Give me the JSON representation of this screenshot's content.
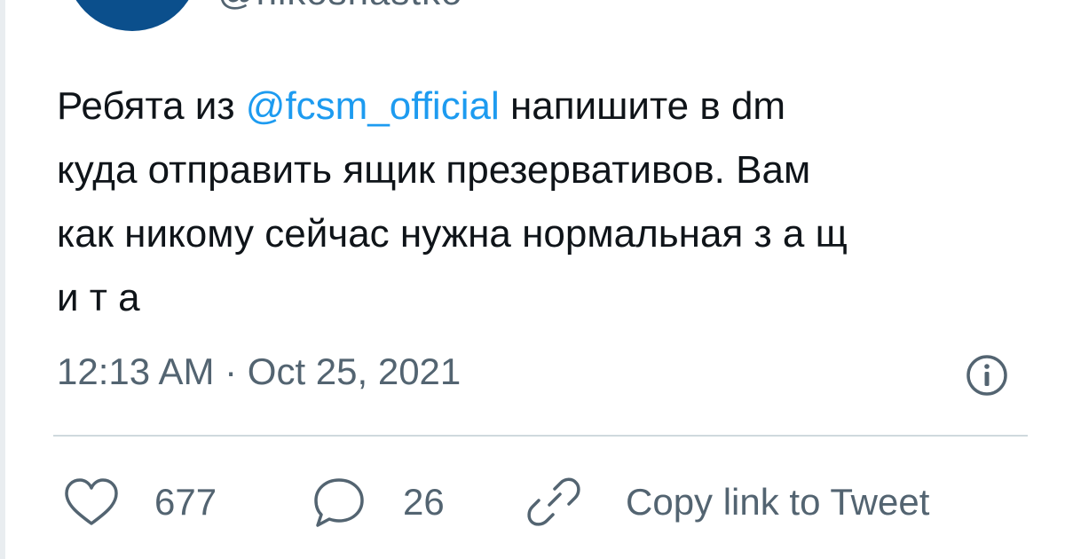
{
  "author": {
    "handle": "@nikosnastko"
  },
  "tweet": {
    "text_before": "Ребята из ",
    "mention": "@fcsm_official",
    "text_after": " напишите в dm\nкуда отправить ящик презервативов. Вам\nкак никому сейчас нужна нормальная з а щ\nи т а",
    "timestamp": "12:13 AM · Oct 25, 2021"
  },
  "actions": {
    "likes": "677",
    "replies": "26",
    "copy_link_label": "Copy link to Tweet"
  },
  "icons": {
    "avatar_color": "#0b4f8c",
    "info": "info-icon",
    "like": "heart-icon",
    "reply": "reply-icon",
    "link": "link-icon",
    "mention_color": "#1d9bf0",
    "muted_color": "#536471"
  }
}
